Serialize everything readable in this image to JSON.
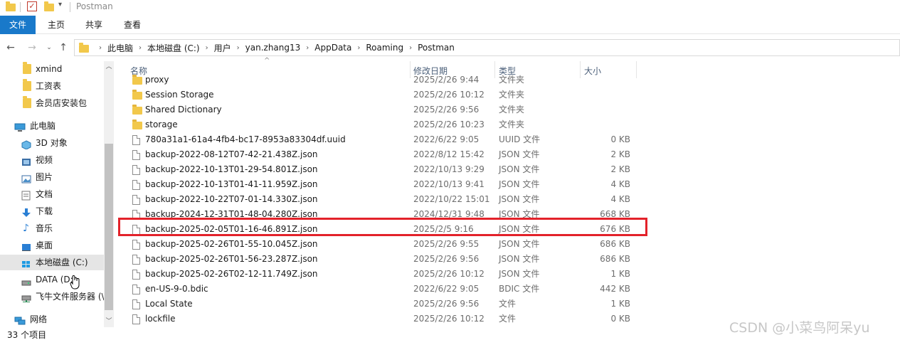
{
  "window": {
    "title": "Postman"
  },
  "ribbon": {
    "tabs": [
      "文件",
      "主页",
      "共享",
      "查看"
    ]
  },
  "address": {
    "crumbs": [
      "此电脑",
      "本地磁盘 (C:)",
      "用户",
      "yan.zhang13",
      "AppData",
      "Roaming",
      "Postman"
    ]
  },
  "sidebar": {
    "items": [
      {
        "label": "xmind",
        "icon": "folder-icon"
      },
      {
        "label": "工资表",
        "icon": "folder-icon"
      },
      {
        "label": "会员店安装包",
        "icon": "folder-icon"
      },
      {
        "label": "此电脑",
        "icon": "computer-icon"
      },
      {
        "label": "3D 对象",
        "icon": "3d-objects-icon"
      },
      {
        "label": "视频",
        "icon": "video-icon"
      },
      {
        "label": "图片",
        "icon": "pictures-icon"
      },
      {
        "label": "文档",
        "icon": "documents-icon"
      },
      {
        "label": "下载",
        "icon": "download-icon"
      },
      {
        "label": "音乐",
        "icon": "music-icon"
      },
      {
        "label": "桌面",
        "icon": "desktop-icon"
      },
      {
        "label": "本地磁盘 (C:)",
        "icon": "drive-c-icon",
        "selected": true
      },
      {
        "label": "DATA (D:)",
        "icon": "drive-icon"
      },
      {
        "label": "飞牛文件服务器 (\\",
        "icon": "network-drive-icon"
      },
      {
        "label": "网络",
        "icon": "network-icon"
      }
    ]
  },
  "columns": {
    "name": "名称",
    "date": "修改日期",
    "type": "类型",
    "size": "大小"
  },
  "files": [
    {
      "name": "proxy",
      "date": "2025/2/26 9:44",
      "type": "文件夹",
      "size": "",
      "kind": "folder"
    },
    {
      "name": "Session Storage",
      "date": "2025/2/26 10:12",
      "type": "文件夹",
      "size": "",
      "kind": "folder"
    },
    {
      "name": "Shared Dictionary",
      "date": "2025/2/26 9:56",
      "type": "文件夹",
      "size": "",
      "kind": "folder"
    },
    {
      "name": "storage",
      "date": "2025/2/26 10:23",
      "type": "文件夹",
      "size": "",
      "kind": "folder"
    },
    {
      "name": "780a31a1-61a4-4fb4-bc17-8953a83304df.uuid",
      "date": "2022/6/22 9:05",
      "type": "UUID 文件",
      "size": "0 KB",
      "kind": "file"
    },
    {
      "name": "backup-2022-08-12T07-42-21.438Z.json",
      "date": "2022/8/12 15:42",
      "type": "JSON 文件",
      "size": "2 KB",
      "kind": "file"
    },
    {
      "name": "backup-2022-10-13T01-29-54.801Z.json",
      "date": "2022/10/13 9:29",
      "type": "JSON 文件",
      "size": "2 KB",
      "kind": "file"
    },
    {
      "name": "backup-2022-10-13T01-41-11.959Z.json",
      "date": "2022/10/13 9:41",
      "type": "JSON 文件",
      "size": "4 KB",
      "kind": "file"
    },
    {
      "name": "backup-2022-10-22T07-01-14.330Z.json",
      "date": "2022/10/22 15:01",
      "type": "JSON 文件",
      "size": "4 KB",
      "kind": "file"
    },
    {
      "name": "backup-2024-12-31T01-48-04.280Z.json",
      "date": "2024/12/31 9:48",
      "type": "JSON 文件",
      "size": "668 KB",
      "kind": "file"
    },
    {
      "name": "backup-2025-02-05T01-16-46.891Z.json",
      "date": "2025/2/5 9:16",
      "type": "JSON 文件",
      "size": "676 KB",
      "kind": "file",
      "highlighted": true
    },
    {
      "name": "backup-2025-02-26T01-55-10.045Z.json",
      "date": "2025/2/26 9:55",
      "type": "JSON 文件",
      "size": "686 KB",
      "kind": "file"
    },
    {
      "name": "backup-2025-02-26T01-56-23.287Z.json",
      "date": "2025/2/26 9:56",
      "type": "JSON 文件",
      "size": "686 KB",
      "kind": "file"
    },
    {
      "name": "backup-2025-02-26T02-12-11.749Z.json",
      "date": "2025/2/26 10:12",
      "type": "JSON 文件",
      "size": "1 KB",
      "kind": "file"
    },
    {
      "name": "en-US-9-0.bdic",
      "date": "2022/6/22 9:05",
      "type": "BDIC 文件",
      "size": "442 KB",
      "kind": "file"
    },
    {
      "name": "Local State",
      "date": "2025/2/26 9:56",
      "type": "文件",
      "size": "1 KB",
      "kind": "file"
    },
    {
      "name": "lockfile",
      "date": "2025/2/26 10:12",
      "type": "文件",
      "size": "0 KB",
      "kind": "file"
    }
  ],
  "status": {
    "count": "33 个项目"
  },
  "watermark": "CSDN @小菜鸟阿呆yu",
  "colors": {
    "accent": "#1979ca",
    "highlight": "#e3222a",
    "folder": "#f2c84b"
  }
}
